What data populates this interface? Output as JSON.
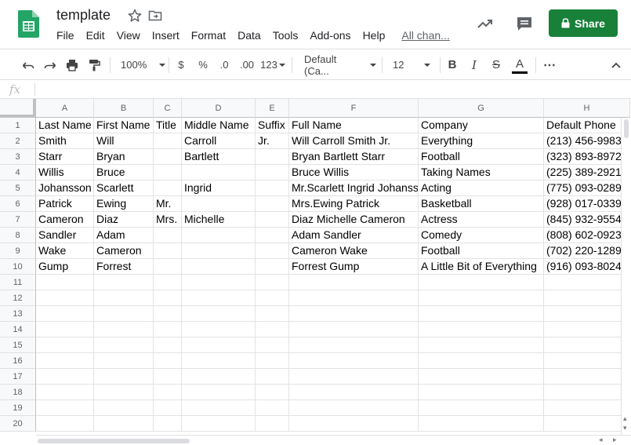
{
  "header": {
    "doc_title": "template",
    "menu": [
      "File",
      "Edit",
      "View",
      "Insert",
      "Format",
      "Data",
      "Tools",
      "Add-ons",
      "Help"
    ],
    "all_changes": "All chan...",
    "share_label": "Share",
    "brand_color": "#188038"
  },
  "toolbar": {
    "zoom": "100%",
    "currency": "$",
    "percent": "%",
    "dec_decrease": ".0",
    "dec_increase": ".00",
    "format_more": "123",
    "font": "Default (Ca...",
    "font_size": "12",
    "bold": "B",
    "italic": "I",
    "strike": "S",
    "text_color": "A",
    "more": "⋯"
  },
  "formula_bar": {
    "fx_label": "fx",
    "value": ""
  },
  "grid": {
    "columns": [
      "A",
      "B",
      "C",
      "D",
      "E",
      "F",
      "G",
      "H"
    ],
    "row_numbers": [
      "1",
      "2",
      "3",
      "4",
      "5",
      "6",
      "7",
      "8",
      "9",
      "10",
      "11",
      "12",
      "13",
      "14",
      "15",
      "16",
      "17",
      "18",
      "19",
      "20"
    ],
    "rows": [
      [
        "Last Name",
        "First Name",
        "Title",
        "Middle Name",
        "Suffix",
        "Full Name",
        "Company",
        "Default Phone"
      ],
      [
        "Smith",
        "Will",
        "",
        "Carroll",
        "Jr.",
        "Will Carroll Smith Jr.",
        "Everything",
        "(213) 456-9983"
      ],
      [
        "Starr",
        "Bryan",
        "",
        "Bartlett",
        "",
        "Bryan Bartlett Starr",
        "Football",
        "(323) 893-8972"
      ],
      [
        "Willis",
        "Bruce",
        "",
        "",
        "",
        "Bruce  Willis",
        "Taking Names",
        "(225) 389-2921"
      ],
      [
        "Johansson",
        "Scarlett",
        "",
        "Ingrid",
        "",
        "Mr.Scarlett Ingrid Johansson",
        "Acting",
        "(775) 093-0289"
      ],
      [
        "Patrick",
        "Ewing",
        "Mr.",
        "",
        "",
        "Mrs.Ewing  Patrick",
        "Basketball",
        "(928) 017-0339"
      ],
      [
        "Cameron",
        "Diaz",
        "Mrs.",
        "Michelle",
        "",
        "Diaz Michelle Cameron",
        "Actress",
        "(845) 932-9554"
      ],
      [
        "Sandler",
        "Adam",
        "",
        "",
        "",
        "Adam  Sandler",
        "Comedy",
        "(808) 602-0923"
      ],
      [
        "Wake",
        "Cameron",
        "",
        "",
        "",
        "Cameron  Wake",
        "Football",
        "(702) 220-1289"
      ],
      [
        "Gump",
        "Forrest",
        "",
        "",
        "",
        "Forrest  Gump",
        "A Little Bit of Everything",
        "(916) 093-8024"
      ]
    ]
  }
}
